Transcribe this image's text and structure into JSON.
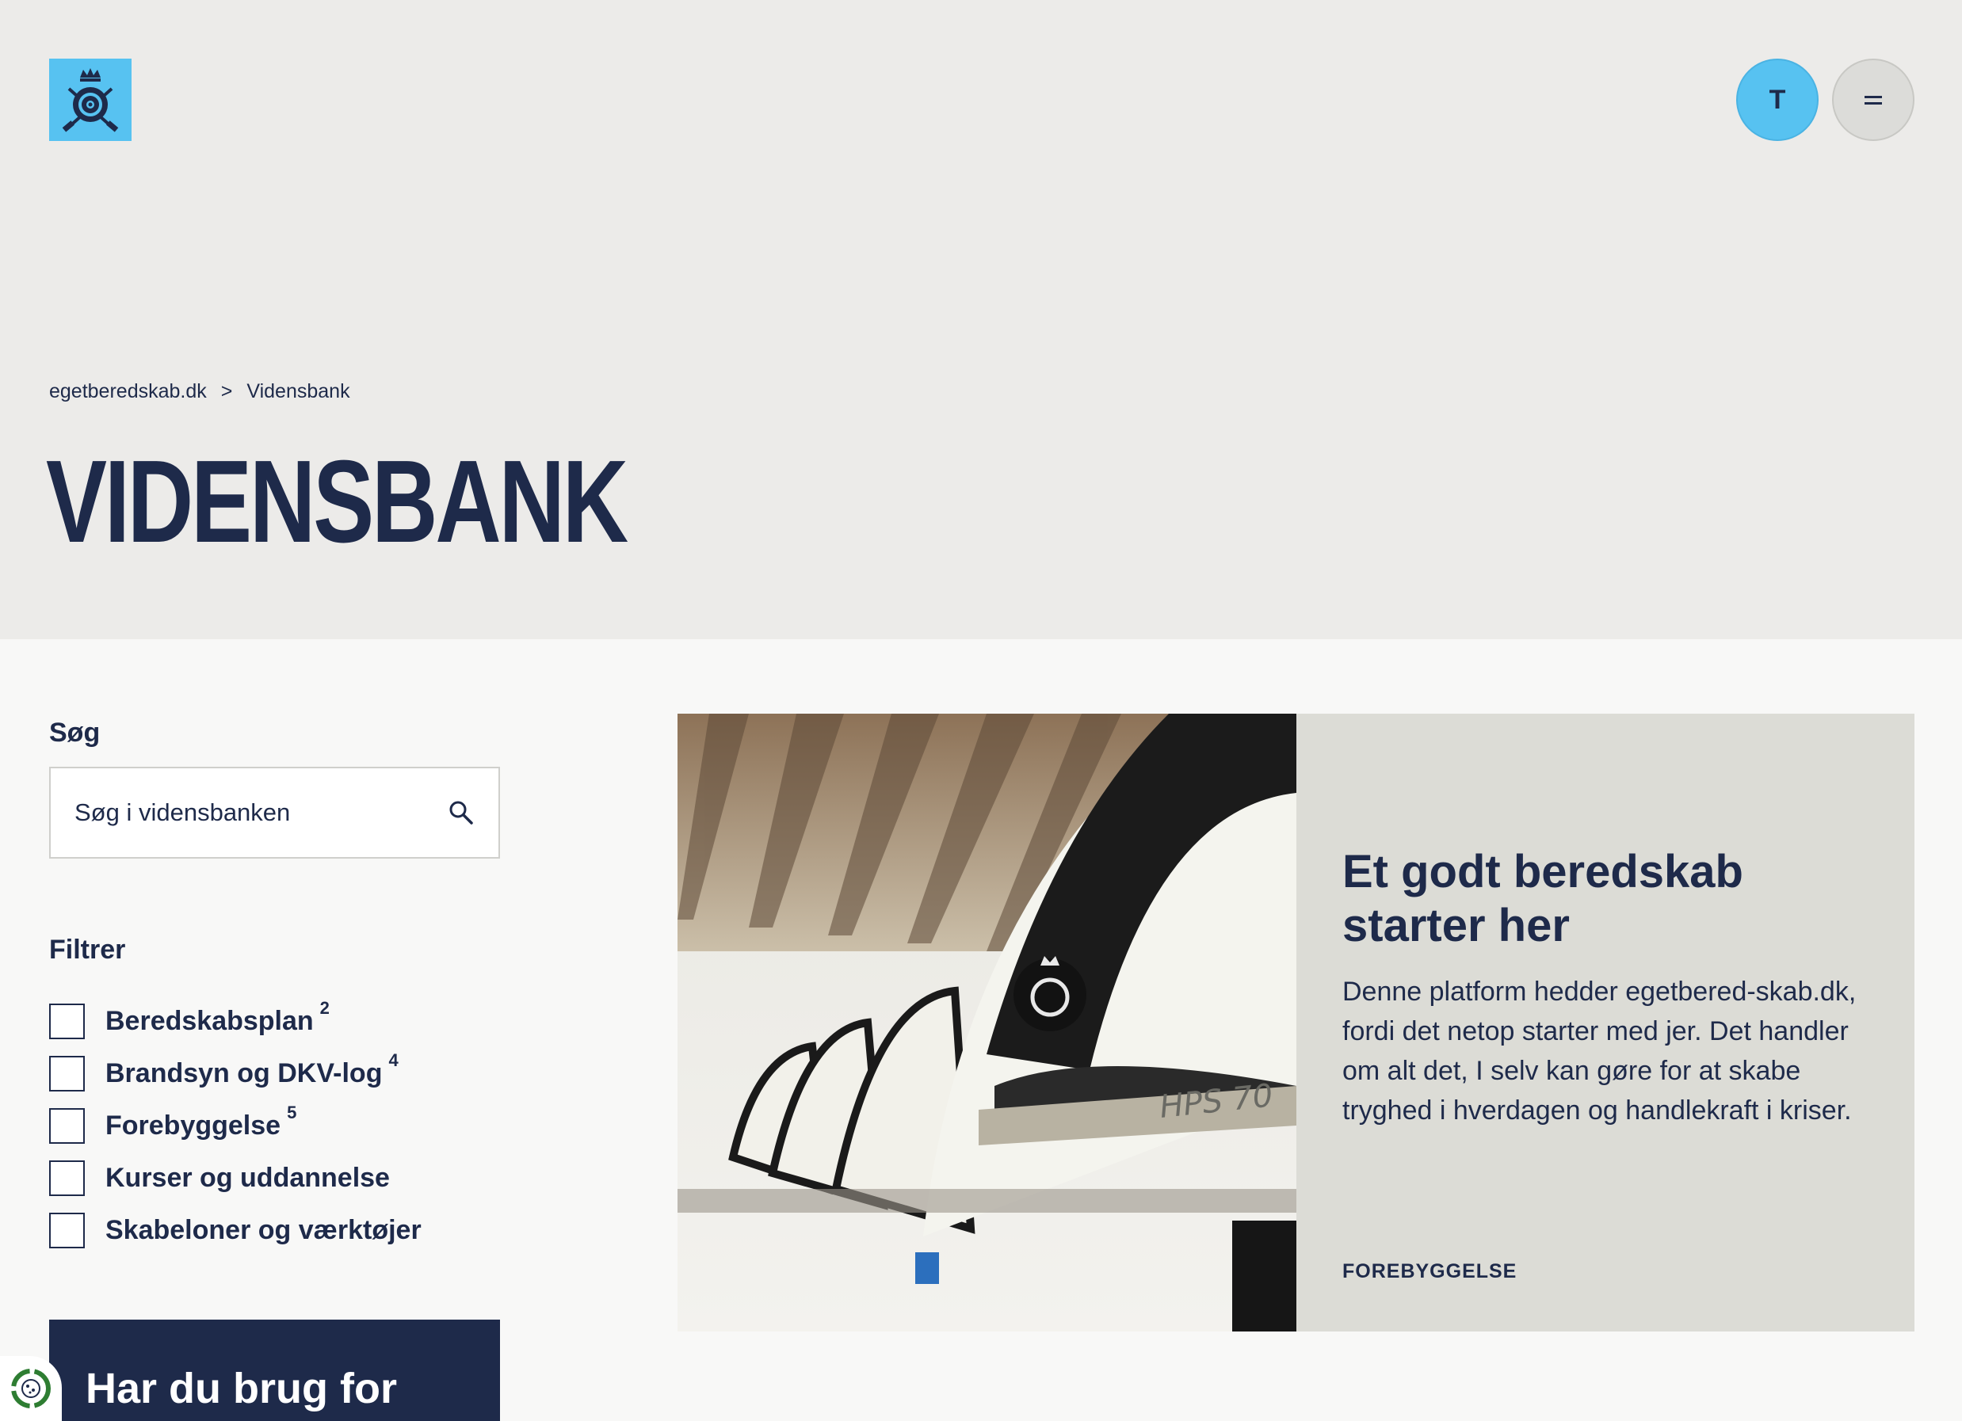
{
  "header": {
    "logo_alt": "Beredskabsstyrelsen logo",
    "user_button_label": "T",
    "menu_icon": "menu-icon"
  },
  "breadcrumb": {
    "home": "egetberedskab.dk",
    "separator": ">",
    "current": "Vidensbank"
  },
  "page": {
    "title": "VIDENSBANK"
  },
  "search": {
    "label": "Søg",
    "placeholder": "Søg i vidensbanken",
    "icon": "search-icon"
  },
  "filters": {
    "label": "Filtrer",
    "items": [
      {
        "label": "Beredskabsplan",
        "count": "2",
        "checked": false
      },
      {
        "label": "Brandsyn og DKV-log",
        "count": "4",
        "checked": false
      },
      {
        "label": "Forebyggelse",
        "count": "5",
        "checked": false
      },
      {
        "label": "Kurser og uddannelse",
        "count": "",
        "checked": false
      },
      {
        "label": "Skabeloner og værktøjer",
        "count": "",
        "checked": false
      }
    ]
  },
  "help_box": {
    "title": "Har du brug for"
  },
  "featured_card": {
    "title": "Et godt beredskab starter her",
    "text": "Denne platform hedder egetbered-skab.dk, fordi det netop starter med jer. Det handler om alt det, I selv kan gøre for at skabe tryghed i hverdagen og handlekraft i kriser.",
    "tag": "FOREBYGGELSE",
    "image_alt": "Row of firefighter helmets",
    "helmet_print": "HPS 70"
  },
  "colors": {
    "navy": "#1e2a4a",
    "accent_blue": "#57c2f1",
    "hero_bg": "#ecebe9",
    "card_bg": "#dcdcd6"
  }
}
